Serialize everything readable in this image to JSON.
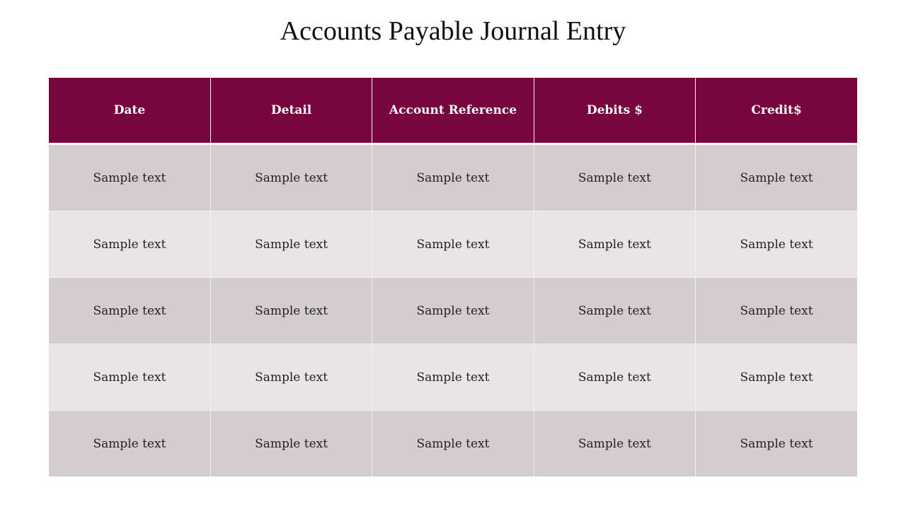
{
  "title": "Accounts Payable Journal Entry",
  "colors": {
    "header_bg": "#77063e",
    "header_text": "#ffffff",
    "row_odd_bg": "#d5cccd",
    "row_even_bg": "#e9e5e6"
  },
  "table": {
    "headers": [
      "Date",
      "Detail",
      "Account Reference",
      "Debits $",
      "Credit$"
    ],
    "rows": [
      [
        "Sample text",
        "Sample text",
        "Sample text",
        "Sample text",
        "Sample text"
      ],
      [
        "Sample text",
        "Sample text",
        "Sample text",
        "Sample text",
        "Sample text"
      ],
      [
        "Sample text",
        "Sample text",
        "Sample text",
        "Sample text",
        "Sample text"
      ],
      [
        "Sample text",
        "Sample text",
        "Sample text",
        "Sample text",
        "Sample text"
      ],
      [
        "Sample text",
        "Sample text",
        "Sample text",
        "Sample text",
        "Sample text"
      ]
    ]
  }
}
